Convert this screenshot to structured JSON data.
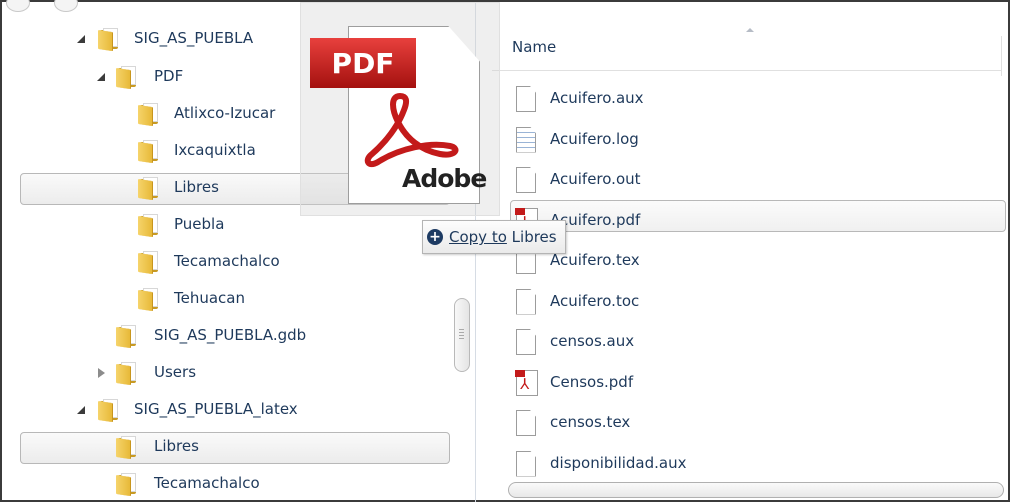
{
  "tree": {
    "items": [
      {
        "label": "SIG_AS_PUEBLA",
        "expander": "open",
        "selected": false
      },
      {
        "label": "PDF",
        "expander": "open",
        "selected": false
      },
      {
        "label": "Atlixco-Izucar",
        "expander": "",
        "selected": false
      },
      {
        "label": "Ixcaquixtla",
        "expander": "",
        "selected": false
      },
      {
        "label": "Libres",
        "expander": "",
        "selected": true
      },
      {
        "label": "Puebla",
        "expander": "",
        "selected": false
      },
      {
        "label": "Tecamachalco",
        "expander": "",
        "selected": false
      },
      {
        "label": "Tehuacan",
        "expander": "",
        "selected": false
      },
      {
        "label": "SIG_AS_PUEBLA.gdb",
        "expander": "",
        "selected": false
      },
      {
        "label": "Users",
        "expander": "closed",
        "selected": false
      },
      {
        "label": "SIG_AS_PUEBLA_latex",
        "expander": "open",
        "selected": false
      },
      {
        "label": "Libres",
        "expander": "",
        "selected": true
      },
      {
        "label": "Tecamachalco",
        "expander": "",
        "selected": false
      }
    ]
  },
  "list": {
    "column_header": "Name",
    "files": [
      {
        "name": "Acuifero.aux",
        "icon": "blank-file-icon"
      },
      {
        "name": "Acuifero.log",
        "icon": "text-file-icon"
      },
      {
        "name": "Acuifero.out",
        "icon": "blank-file-icon"
      },
      {
        "name": "Acuifero.pdf",
        "icon": "pdf-file-icon"
      },
      {
        "name": "Acuifero.tex",
        "icon": "blank-file-icon"
      },
      {
        "name": "Acuifero.toc",
        "icon": "blank-file-icon"
      },
      {
        "name": "censos.aux",
        "icon": "blank-file-icon"
      },
      {
        "name": "Censos.pdf",
        "icon": "pdf-file-icon"
      },
      {
        "name": "censos.tex",
        "icon": "blank-file-icon"
      },
      {
        "name": "disponibilidad.aux",
        "icon": "blank-file-icon"
      }
    ]
  },
  "drag": {
    "tag_text": "PDF",
    "brand_text": "Adobe",
    "tooltip_action": "Copy to",
    "tooltip_target": "Libres"
  },
  "colors": {
    "text": "#1e395b",
    "folder": "#e7b939",
    "pdf_red": "#c31a1a"
  }
}
